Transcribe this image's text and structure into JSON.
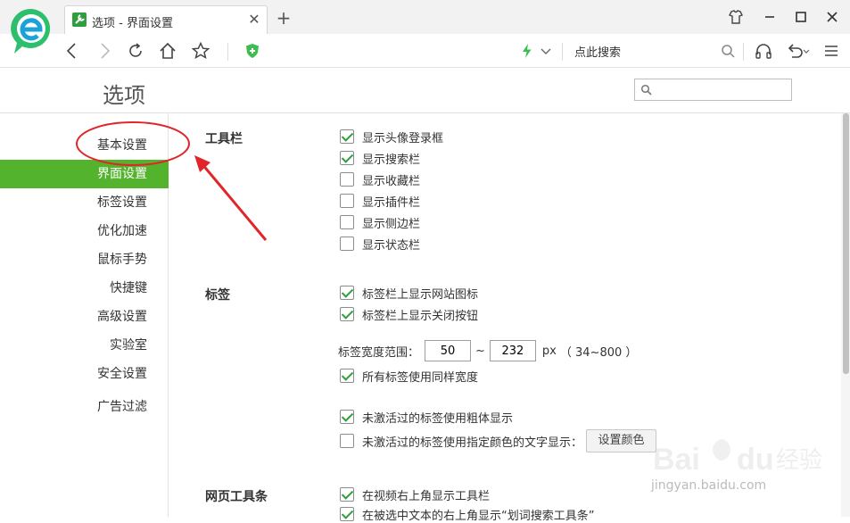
{
  "browser": {
    "tab_title": "选项 - 界面设置",
    "address_search": "点此搜索"
  },
  "page": {
    "title": "选项",
    "search_placeholder": ""
  },
  "sidebar": {
    "items": [
      {
        "label": "基本设置",
        "active": false
      },
      {
        "label": "界面设置",
        "active": true
      },
      {
        "label": "标签设置",
        "active": false
      },
      {
        "label": "优化加速",
        "active": false
      },
      {
        "label": "鼠标手势",
        "active": false
      },
      {
        "label": "快捷键",
        "active": false
      },
      {
        "label": "高级设置",
        "active": false
      },
      {
        "label": "实验室",
        "active": false
      },
      {
        "label": "安全设置",
        "active": false
      },
      {
        "label": "广告过滤",
        "active": false
      }
    ]
  },
  "toolbar_section": {
    "title": "工具栏",
    "options": [
      {
        "label": "显示头像登录框",
        "checked": true
      },
      {
        "label": "显示搜索栏",
        "checked": true
      },
      {
        "label": "显示收藏栏",
        "checked": false
      },
      {
        "label": "显示插件栏",
        "checked": false
      },
      {
        "label": "显示侧边栏",
        "checked": false
      },
      {
        "label": "显示状态栏",
        "checked": false
      }
    ]
  },
  "tabs_section": {
    "title": "标签",
    "options": [
      {
        "label": "标签栏上显示网站图标",
        "checked": true
      },
      {
        "label": "标签栏上显示关闭按钮",
        "checked": true
      }
    ],
    "width_range": {
      "label": "标签宽度范围：",
      "min": "50",
      "separator": "~",
      "max": "232",
      "unit": "px",
      "hint": "（ 34~800 ）"
    },
    "same_width": {
      "label": "所有标签使用同样宽度",
      "checked": true
    },
    "bold_inactive": {
      "label": "未激活过的标签使用粗体显示",
      "checked": true
    },
    "color_inactive": {
      "label": "未激活过的标签使用指定颜色的文字显示：",
      "checked": false
    },
    "set_color_button": "设置颜色"
  },
  "webtoolbar_section": {
    "title": "网页工具条",
    "options": [
      {
        "label": "在视频右上角显示工具栏",
        "checked": true
      },
      {
        "label": "在被选中文本的右上角显示“划词搜索工具条”",
        "checked": true
      }
    ]
  },
  "watermark": {
    "text": "jingyan.baidu.com"
  },
  "colors": {
    "accent_green": "#53b32c",
    "check_green": "#2f9e3f",
    "annotation_red": "#e0262a"
  }
}
